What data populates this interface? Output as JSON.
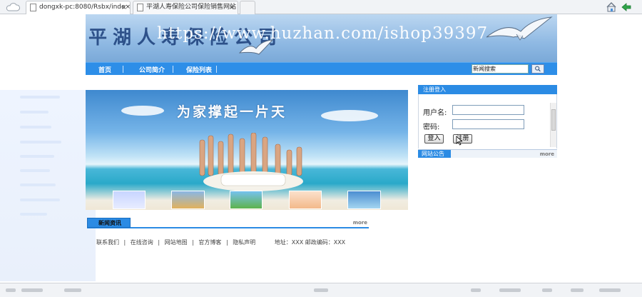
{
  "browser": {
    "tabs": [
      {
        "label": "dongxk-pc:8080/Rsbx/inde×",
        "active": true
      },
      {
        "label": "平湖人寿保险公司保险销售网站",
        "active": false
      }
    ],
    "close_glyph": "×"
  },
  "site": {
    "banner_title": "平湖人寿保险公司",
    "watermark": "https://www.huzhan.com/ishop39397",
    "nav": [
      "首页",
      "公司简介",
      "保险列表"
    ],
    "search_value": "新闻搜索",
    "hero_slogan": "为家撑起一片天"
  },
  "login": {
    "header": "注册登入",
    "username_label": "用户名:",
    "password_label": "密码:",
    "login_button": "登入",
    "register_button": "注册"
  },
  "notice": {
    "tab": "网站公告",
    "more": "more"
  },
  "news": {
    "tab": "新闻资讯",
    "more": "more"
  },
  "footer": {
    "links": [
      "联系我们",
      "在线咨询",
      "网站地图",
      "官方博客",
      "隐私声明"
    ],
    "separator": "|",
    "address": "地址：XXX 邮政编码：XXX"
  },
  "colors": {
    "primary_blue": "#2b8be4",
    "banner_blue": "#8fb9e3"
  }
}
